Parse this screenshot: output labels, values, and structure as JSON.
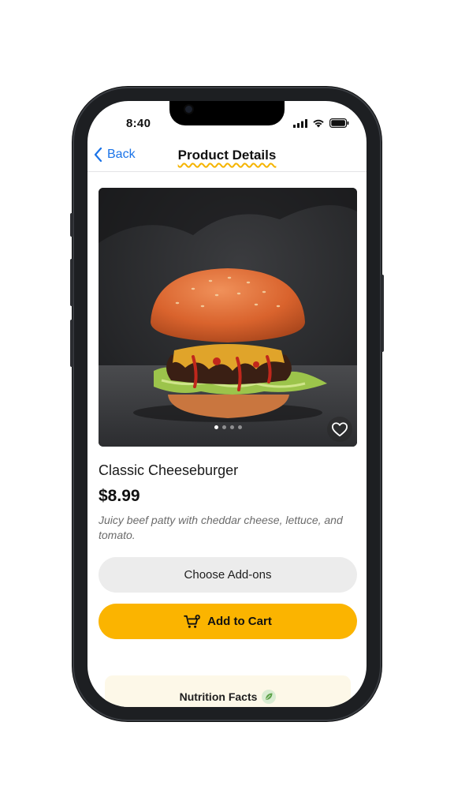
{
  "status_bar": {
    "time": "8:40"
  },
  "nav": {
    "back_label": "Back",
    "title": "Product Details"
  },
  "product": {
    "name": "Classic Cheeseburger",
    "price": "$8.99",
    "description": "Juicy beef patty with cheddar cheese, lettuce, and tomato.",
    "image_alt": "Classic Cheeseburger photo",
    "carousel": {
      "page_count": 4,
      "active_index": 0
    }
  },
  "actions": {
    "addons_label": "Choose Add-ons",
    "cart_label": "Add to Cart"
  },
  "nutrition": {
    "title": "Nutrition Facts"
  },
  "icons": {
    "back": "chevron-left-icon",
    "favorite": "heart-icon",
    "cart": "cart-plus-icon",
    "nutrition": "leaf-icon",
    "signal": "cellular-signal-icon",
    "wifi": "wifi-icon",
    "battery": "battery-icon"
  },
  "colors": {
    "accent_blue": "#1a73e8",
    "cart_button": "#fbb400",
    "addons_button": "#ececec",
    "title_underline": "#f5b400",
    "nutrition_bg": "#fdf8e8"
  }
}
